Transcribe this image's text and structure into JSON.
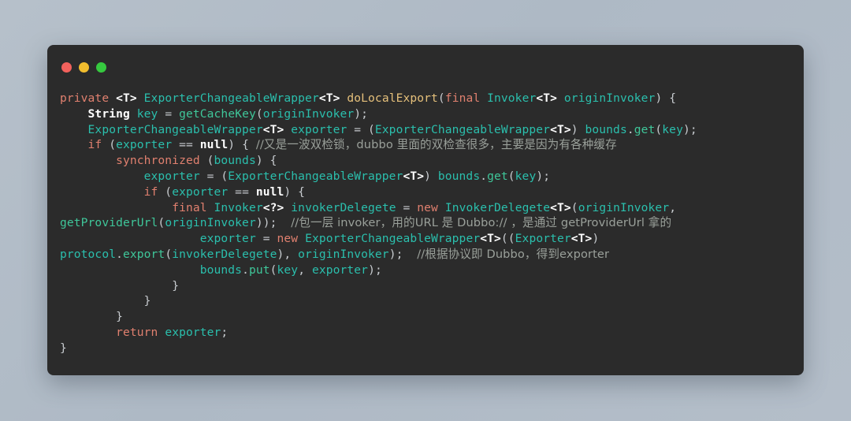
{
  "window": {
    "background_color": "#2b2b2b",
    "page_background_color": "#b2bdc9",
    "traffic_lights": [
      {
        "name": "close",
        "color": "#f2615c"
      },
      {
        "name": "minimize",
        "color": "#f1bd2e"
      },
      {
        "name": "maximize",
        "color": "#36c93f"
      }
    ]
  },
  "theme": {
    "keyword_color": "#e0806f",
    "type_color": "#2bbfad",
    "function_color": "#3fc79a",
    "method_name_color": "#e5c07b",
    "comment_color": "#9aa09a",
    "text_color": "#cfd3d6"
  },
  "code": {
    "language": "java",
    "lines": [
      "private <T> ExporterChangeableWrapper<T> doLocalExport(final Invoker<T> originInvoker) {",
      "    String key = getCacheKey(originInvoker);",
      "    ExporterChangeableWrapper<T> exporter = (ExporterChangeableWrapper<T>) bounds.get(key);",
      "    if (exporter == null) { //又是一波双检锁，dubbo 里面的双检查很多，主要是因为有各种缓存",
      "        synchronized (bounds) {",
      "            exporter = (ExporterChangeableWrapper<T>) bounds.get(key);",
      "            if (exporter == null) {",
      "                final Invoker<?> invokerDelegete = new InvokerDelegete<T>(originInvoker, getProviderUrl(originInvoker)); //包一层 invoker，用的URL 是 Dubbo:// ，是通过 getProviderUrl 拿的",
      "                exporter = new ExporterChangeableWrapper<T>((Exporter<T>) protocol.export(invokerDelegete), originInvoker); //根据协议即 Dubbo，得到exporter",
      "                bounds.put(key, exporter);",
      "            }",
      "        }",
      "    }",
      "    return exporter;",
      "}"
    ],
    "comments": [
      "//又是一波双检锁，dubbo 里面的双检查很多，主要是因为有各种缓存",
      "//包一层 invoker，用的URL 是 Dubbo:// ，是通过 getProviderUrl 拿的",
      "//根据协议即 Dubbo，得到exporter"
    ],
    "tokens": {
      "l1": {
        "kw_private": "private",
        "generic_t": "<T>",
        "type_wrapper": "ExporterChangeableWrapper",
        "generic_t2": "<T>",
        "method": "doLocalExport",
        "paren_open": "(",
        "kw_final": "final",
        "type_invoker": "Invoker",
        "generic_t3": "<T>",
        "param": "originInvoker",
        "tail": ") {"
      },
      "l2": {
        "type_string": "String",
        "var_key": "key",
        "eq": " = ",
        "fn": "getCacheKey",
        "arg": "originInvoker",
        "tail": ");"
      },
      "l3": {
        "type_wrapper": "ExporterChangeableWrapper",
        "generic": "<T>",
        "var": "exporter",
        "eq": " = (",
        "cast_type": "ExporterChangeableWrapper",
        "cast_generic": "<T>",
        "close": ") ",
        "obj": "bounds",
        "dot": ".",
        "fn": "get",
        "arg": "key",
        "tail": ");"
      },
      "l4": {
        "kw_if": "if",
        "open": " (",
        "var": "exporter",
        "op": " == ",
        "nul": "null",
        "close": ") { ",
        "comment": "//又是一波双检锁，dubbo 里面的双检查很多，主要是因为有各种缓存"
      },
      "l5": {
        "kw": "synchronized",
        "open": " (",
        "var": "bounds",
        "tail": ") {"
      },
      "l6": {
        "var": "exporter",
        "eq": " = (",
        "cast_type": "ExporterChangeableWrapper",
        "cast_generic": "<T>",
        "close": ") ",
        "obj": "bounds",
        "dot": ".",
        "fn": "get",
        "arg": "key",
        "tail": ");"
      },
      "l7": {
        "kw_if": "if",
        "open": " (",
        "var": "exporter",
        "op": " == ",
        "nul": "null",
        "tail": ") {"
      },
      "l8": {
        "kw_final": "final",
        "type_invoker": "Invoker",
        "generic": "<?>",
        "var": "invokerDelegete",
        "eq": " = ",
        "kw_new": "new",
        "type_delegete": "InvokerDelegete",
        "generic2": "<T>",
        "arg1": "originInvoker",
        "comma": ", ",
        "fn": "getProviderUrl",
        "arg2": "originInvoker",
        "tail": "));  ",
        "comment": "//包一层 invoker，用的URL 是 Dubbo:// ，是通过 getProviderUrl 拿的"
      },
      "l9": {
        "var": "exporter",
        "eq": " = ",
        "kw_new": "new",
        "type_wrapper": "ExporterChangeableWrapper",
        "generic": "<T>",
        "cast_type": "Exporter",
        "cast_generic": "<T>",
        "obj": "protocol",
        "dot": ".",
        "fn": "export",
        "arg1": "invokerDelegete",
        "comma": "), ",
        "arg2": "originInvoker",
        "tail": ");  ",
        "comment": "//根据协议即 Dubbo，得到exporter"
      },
      "l10": {
        "obj": "bounds",
        "dot": ".",
        "fn": "put",
        "arg1": "key",
        "comma": ", ",
        "arg2": "exporter",
        "tail": ");"
      },
      "l11": {
        "brace": "}"
      },
      "l12": {
        "brace": "}"
      },
      "l13": {
        "brace": "}"
      },
      "l14": {
        "kw_return": "return",
        "var": "exporter",
        "tail": ";"
      },
      "l15": {
        "brace": "}"
      }
    }
  }
}
